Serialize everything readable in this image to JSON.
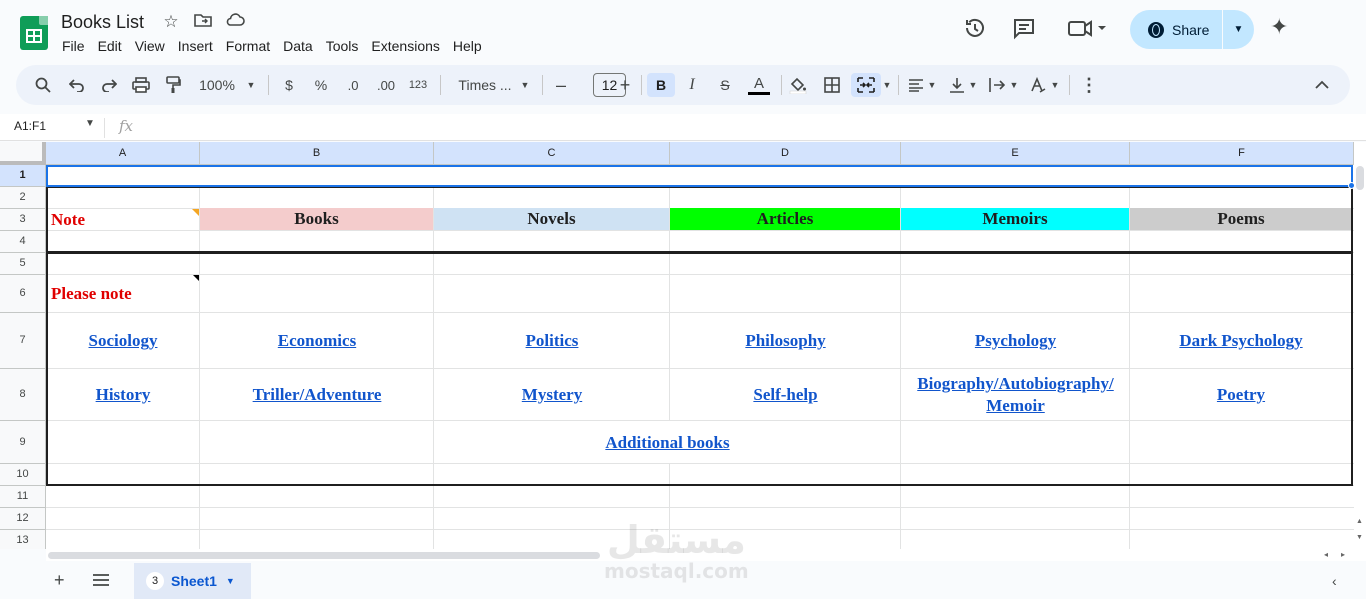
{
  "title_bar": {
    "doc_title": "Books List",
    "menu": [
      "File",
      "Edit",
      "View",
      "Insert",
      "Format",
      "Data",
      "Tools",
      "Extensions",
      "Help"
    ],
    "share_label": "Share"
  },
  "toolbar": {
    "zoom": "100%",
    "currency": "$",
    "percent": "%",
    "dec_less": ".0",
    "dec_more": ".00",
    "format_123": "123",
    "font_name": "Times ...",
    "font_size": "12",
    "bold": "B",
    "italic": "I",
    "strike": "S",
    "text_color": "A"
  },
  "formula_bar": {
    "name_box": "A1:F1",
    "fx": "fx"
  },
  "columns": [
    "A",
    "B",
    "C",
    "D",
    "E",
    "F"
  ],
  "rows": [
    "1",
    "2",
    "3",
    "4",
    "5",
    "6",
    "7",
    "8",
    "9",
    "10",
    "11",
    "12",
    "13"
  ],
  "cells": {
    "a3": "Note",
    "b3": "Books",
    "c3": "Novels",
    "d3": "Articles",
    "e3": "Memoirs",
    "f3": "Poems",
    "a6": "Please note",
    "a7": "Sociology",
    "b7": "Economics",
    "c7": "Politics",
    "d7": "Philosophy",
    "e7": "Psychology",
    "f7": "Dark Psychology",
    "a8": "History",
    "b8": "Triller/Adventure",
    "c8": "Mystery",
    "d8": "Self-help",
    "e8": "Biography/Autobiography/ Memoir",
    "f8": "Poetry",
    "c9": "Additional books"
  },
  "colors": {
    "books_fill": "#f4cccc",
    "novels_fill": "#cfe2f3",
    "articles_fill": "#00ff00",
    "memoirs_fill": "#00ffff",
    "poems_fill": "#cccccc",
    "link": "#1155cc",
    "note_red": "#e00000"
  },
  "sheet": {
    "count_badge": "3",
    "name": "Sheet1"
  },
  "watermark": {
    "arabic": "مستقل",
    "latin": "mostaql.com"
  }
}
